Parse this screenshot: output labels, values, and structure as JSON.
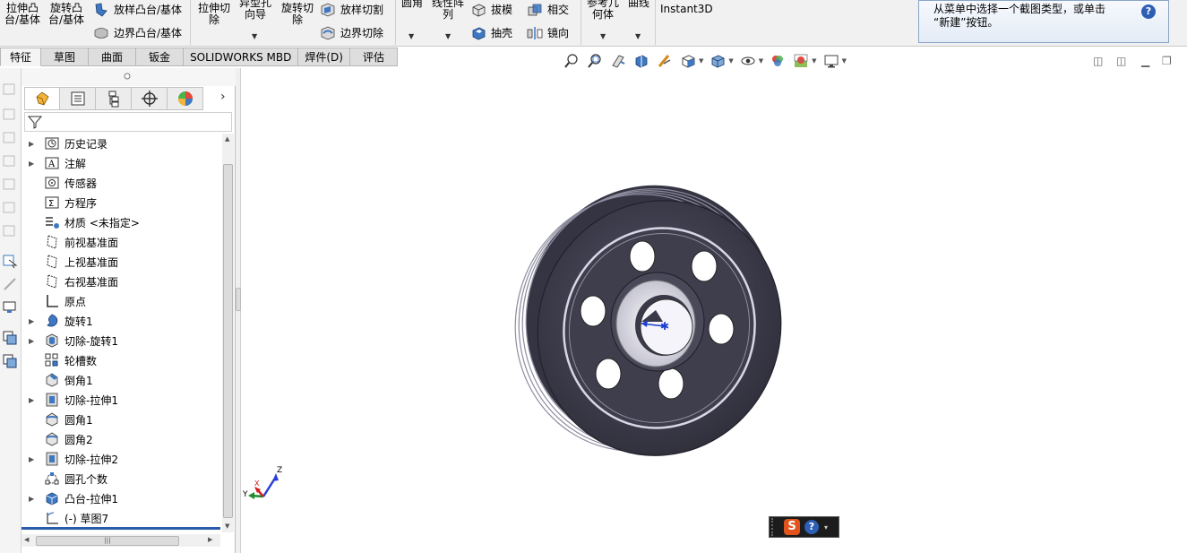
{
  "ribbon": {
    "buttons": {
      "extrude_boss": "拉伸凸\n台/基体",
      "revolve_boss": "旋转凸\n台/基体",
      "loft_boss": "放样凸台/基体",
      "boundary_boss": "边界凸台/基体",
      "extrude_cut": "拉伸切\n除",
      "hole_wizard": "异型孔\n向导",
      "revolve_cut": "旋转切\n除",
      "loft_cut": "放样切割",
      "boundary_cut": "边界切除",
      "fillet": "圆角",
      "linear_pattern": "线性阵\n列",
      "draft": "拔模",
      "shell": "抽壳",
      "intersect": "相交",
      "mirror": "镜向",
      "ref_geometry": "参考几\n何体",
      "curves": "曲线",
      "instant3d": "Instant3D"
    },
    "message": {
      "text": "从菜单中选择一个截图类型，或单击\n“新建”按钮。",
      "help": "?"
    }
  },
  "tabs": [
    {
      "label": "特征",
      "active": true
    },
    {
      "label": "草图",
      "active": false
    },
    {
      "label": "曲面",
      "active": false
    },
    {
      "label": "钣金",
      "active": false
    },
    {
      "label": "SOLIDWORKS MBD",
      "active": false
    },
    {
      "label": "焊件(D)",
      "active": false
    },
    {
      "label": "评估",
      "active": false
    }
  ],
  "feature_tree": {
    "items": [
      {
        "label": "历史记录",
        "expandable": true,
        "icon": "history-icon"
      },
      {
        "label": "注解",
        "expandable": true,
        "icon": "annotation-icon"
      },
      {
        "label": "传感器",
        "expandable": false,
        "icon": "sensor-icon"
      },
      {
        "label": "方程序",
        "expandable": false,
        "icon": "equation-icon"
      },
      {
        "label": "材质 <未指定>",
        "expandable": false,
        "icon": "material-icon"
      },
      {
        "label": "前视基准面",
        "expandable": false,
        "icon": "plane-icon"
      },
      {
        "label": "上视基准面",
        "expandable": false,
        "icon": "plane-icon"
      },
      {
        "label": "右视基准面",
        "expandable": false,
        "icon": "plane-icon"
      },
      {
        "label": "原点",
        "expandable": false,
        "icon": "origin-icon"
      },
      {
        "label": "旋转1",
        "expandable": true,
        "icon": "revolve-icon"
      },
      {
        "label": "切除-旋转1",
        "expandable": true,
        "icon": "cut-revolve-icon"
      },
      {
        "label": "轮槽数",
        "expandable": false,
        "icon": "pattern-icon"
      },
      {
        "label": "倒角1",
        "expandable": false,
        "icon": "chamfer-icon"
      },
      {
        "label": "切除-拉伸1",
        "expandable": true,
        "icon": "cut-extrude-icon"
      },
      {
        "label": "圆角1",
        "expandable": false,
        "icon": "fillet-icon"
      },
      {
        "label": "圆角2",
        "expandable": false,
        "icon": "fillet-icon"
      },
      {
        "label": "切除-拉伸2",
        "expandable": true,
        "icon": "cut-extrude-icon"
      },
      {
        "label": "圆孔个数",
        "expandable": false,
        "icon": "circular-pattern-icon"
      },
      {
        "label": "凸台-拉伸1",
        "expandable": true,
        "icon": "boss-extrude-icon"
      },
      {
        "label": "(-) 草图7",
        "expandable": false,
        "icon": "sketch-icon"
      }
    ]
  },
  "triad": {
    "x": "X",
    "y": "Y",
    "z": "Z"
  },
  "ime": {
    "logo": "S",
    "help": "?"
  },
  "colors": {
    "wheel_dark": "#3d3c4a",
    "accent_blue": "#2a5bab"
  }
}
